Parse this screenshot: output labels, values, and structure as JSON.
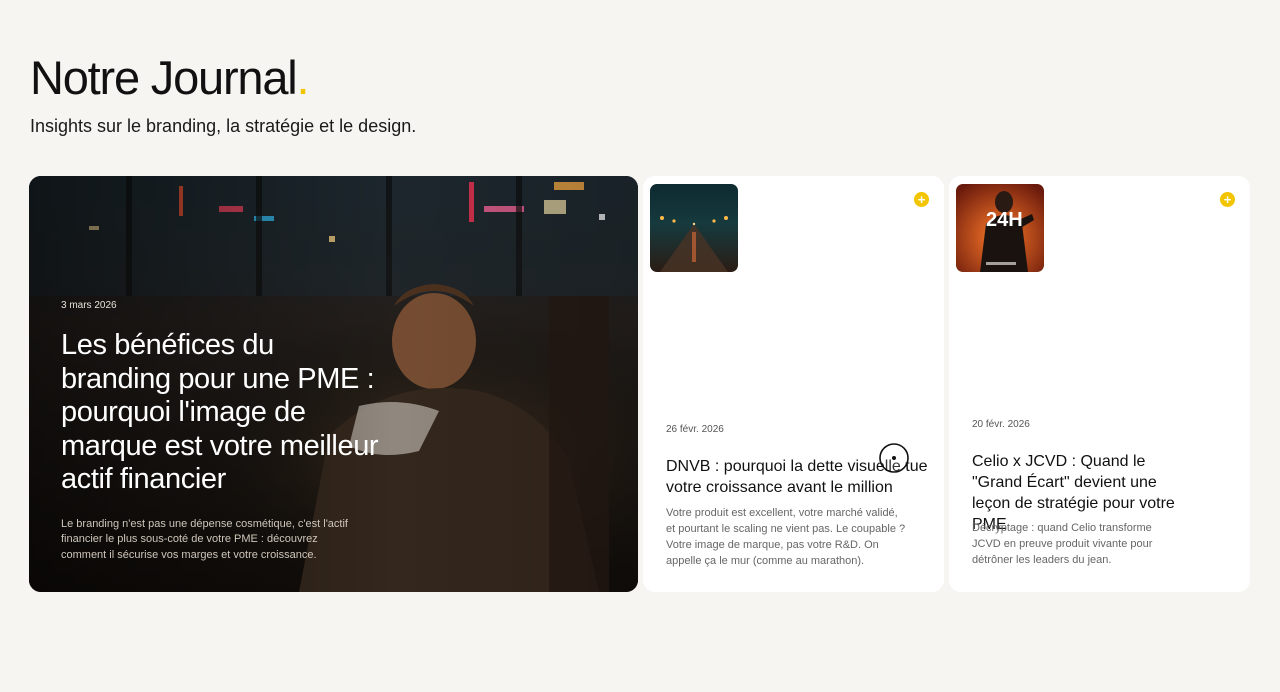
{
  "header": {
    "title": "Notre Journal",
    "title_dot": ".",
    "subtitle": "Insights sur le branding, la stratégie et le design."
  },
  "colors": {
    "accent": "#f2c500",
    "background": "#f6f5f2",
    "card": "#ffffff"
  },
  "featured": {
    "date": "3 mars 2026",
    "title": "Les bénéfices du branding pour une PME : pourquoi l'image de marque est votre meilleur actif financier",
    "excerpt": "Le branding n'est pas une dépense cosmétique, c'est l'actif financier le plus sous-coté de votre PME : découvrez comment il sécurise vos marges et votre croissance."
  },
  "articles": [
    {
      "date": "26 févr. 2026",
      "title": "DNVB : pourquoi la dette visuelle tue votre croissance avant le million",
      "excerpt": "Votre produit est excellent, votre marché validé, et pourtant le scaling ne vient pas. Le coupable ? Votre image de marque, pas votre R&D. On appelle ça le mur (comme au marathon).",
      "icon": "plus-icon"
    },
    {
      "date": "20 févr. 2026",
      "title": "Celio x JCVD : Quand le \"Grand Écart\" devient une leçon de stratégie pour votre PME",
      "excerpt": "Décryptage : quand Celio transforme JCVD en preuve produit vivante pour détrôner les leaders du jean.",
      "thumb_text": "24H",
      "icon": "plus-icon"
    }
  ]
}
